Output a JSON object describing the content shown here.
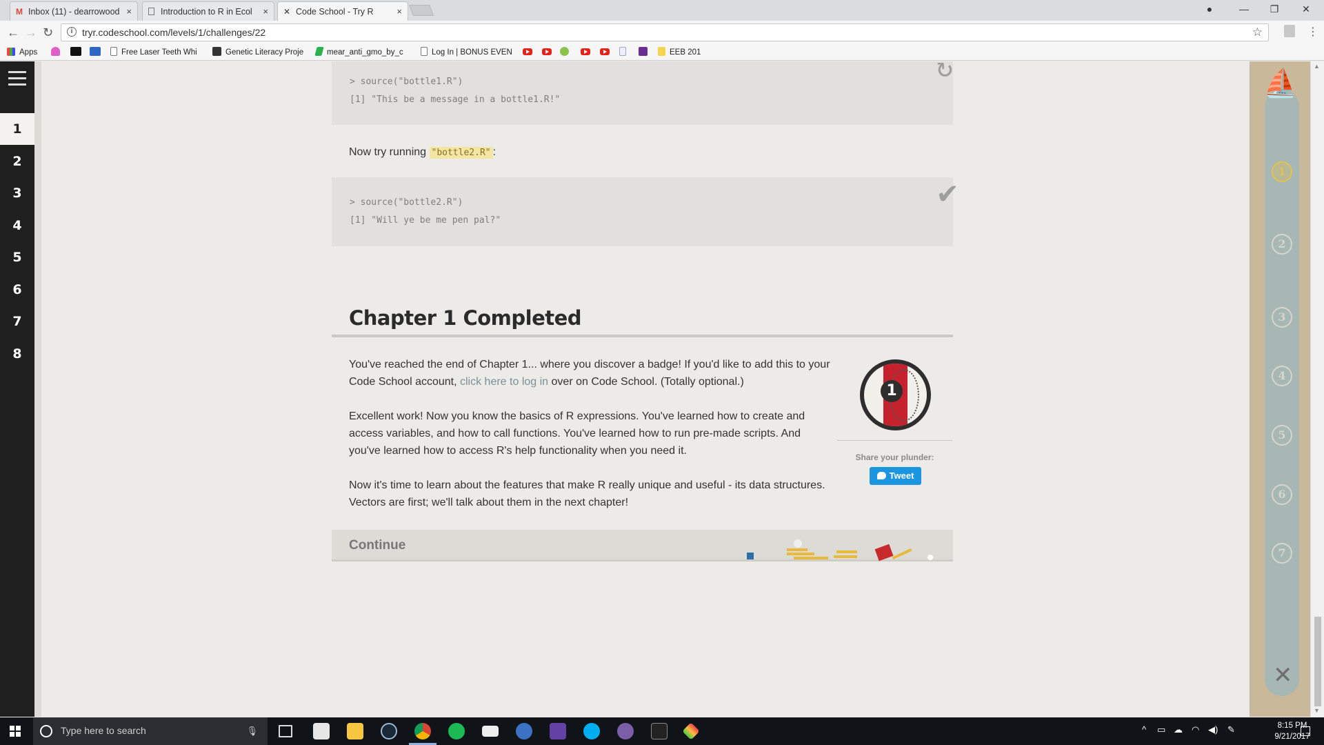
{
  "browser": {
    "tabs": [
      {
        "title": "Inbox (11) - dearrowood",
        "icon": "gmail-icon",
        "close": "×"
      },
      {
        "title": "Introduction to R in Ecol",
        "icon": "document-icon",
        "close": "×"
      },
      {
        "title": "Code School - Try R",
        "icon": "codeschool-icon",
        "close": "×"
      }
    ],
    "url": "tryr.codeschool.com/levels/1/challenges/22",
    "bookmarks": [
      {
        "label": "Apps"
      },
      {
        "label": "Free Laser Teeth Whi"
      },
      {
        "label": "Genetic Literacy Proje"
      },
      {
        "label": "mear_anti_gmo_by_c"
      },
      {
        "label": "Log In | BONUS EVEN"
      },
      {
        "label": "EEB 201"
      }
    ]
  },
  "sidebar": {
    "levels": [
      "1",
      "2",
      "3",
      "4",
      "5",
      "6",
      "7",
      "8"
    ],
    "active_level": "1"
  },
  "lesson": {
    "code_block_1": {
      "lines": [
        "> source(\"bottle1.R\")",
        "[1] \"This be a message in a bottle1.R!\""
      ]
    },
    "prompt_prefix": "Now try running",
    "prompt_code": "\"bottle2.R\"",
    "prompt_suffix": ":",
    "code_block_2": {
      "lines": [
        "> source(\"bottle2.R\")",
        "[1] \"Will ye be me pen pal?\""
      ]
    },
    "chapter_title": "Chapter 1 Completed",
    "para1_a": "You've reached the end of Chapter 1... where you discover a badge! If you'd like to add this to your Code School account,",
    "para1_link": "click here to log in",
    "para1_b": "over on Code School. (Totally optional.)",
    "para2": "Excellent work! Now you know the basics of R expressions. You've learned how to create and access variables, and how to call functions. You've learned how to run pre-made scripts. And you've learned how to access R's help functionality when you need it.",
    "para3": "Now it's time to learn about the features that make R really unique and useful - its data structures. Vectors are first; we'll talk about them in the next chapter!",
    "badge_number": "1",
    "share_label": "Share your plunder:",
    "tweet_label": "Tweet",
    "continue_label": "Continue"
  },
  "map": {
    "nodes": [
      "1",
      "2",
      "3",
      "4",
      "5",
      "6",
      "7"
    ],
    "current_node": "1"
  },
  "taskbar": {
    "search_placeholder": "Type here to search",
    "time": "8:15 PM",
    "date": "9/21/2017"
  },
  "colors": {
    "accent_tweet": "#1b95e0",
    "badge_red": "#c6222d",
    "highlight": "#f3e6a4",
    "sidebar_bg": "#1f1f1f"
  }
}
